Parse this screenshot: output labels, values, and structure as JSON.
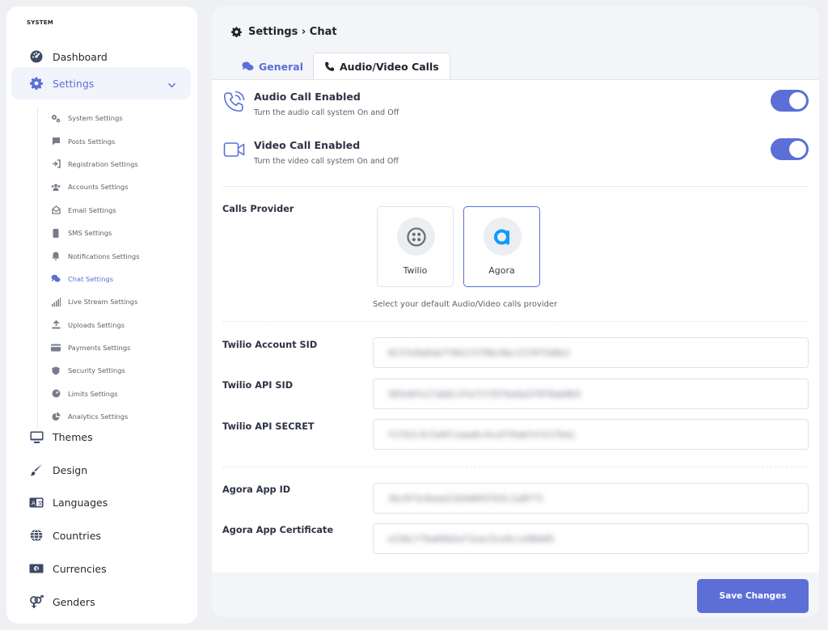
{
  "sidebar": {
    "section_title": "SYSTEM",
    "dashboard": "Dashboard",
    "settings": "Settings",
    "sub_items": [
      "System Settings",
      "Posts Settings",
      "Registration Settings",
      "Accounts Settings",
      "Email Settings",
      "SMS Settings",
      "Notifications Settings",
      "Chat Settings",
      "Live Stream Settings",
      "Uploads Settings",
      "Payments Settings",
      "Security Settings",
      "Limits Settings",
      "Analytics Settings"
    ],
    "bottom_items": [
      "Themes",
      "Design",
      "Languages",
      "Countries",
      "Currencies",
      "Genders"
    ]
  },
  "header": {
    "breadcrumb": "Settings › Chat"
  },
  "tabs": {
    "general": "General",
    "calls": "Audio/Video Calls"
  },
  "calls": {
    "audio_title": "Audio Call Enabled",
    "audio_desc": "Turn the audio call system On and Off",
    "audio_enabled": true,
    "video_title": "Video Call Enabled",
    "video_desc": "Turn the video call system On and Off",
    "video_enabled": true
  },
  "provider": {
    "label": "Calls Provider",
    "options": [
      "Twilio",
      "Agora"
    ],
    "selected": "Agora",
    "hint": "Select your default Audio/Video calls provider"
  },
  "fields": {
    "twilio_sid_label": "Twilio Account SID",
    "twilio_sid_value": "AC3fe9a6ab7f6b1f2f0bc8ac21f0f5d8a1",
    "twilio_api_sid_label": "Twilio API SID",
    "twilio_api_sid_value": "SK5e0fe17ab6c3fa71f35fbe6a3f0f0ab0b5",
    "twilio_api_secret_label": "Twilio API SECRET",
    "twilio_api_secret_value": "Y1fb2c4c5a9fcaaa6c4ce5f6abfefe17bdj",
    "agora_app_id_label": "Agora App ID",
    "agora_app_id_value": "3bc0f3c6ead11b4d0437b5c1a8f71",
    "agora_cert_label": "Agora App Certificate",
    "agora_cert_value": "e13bcf7ba69d2ef1eac5ce9cce96b05"
  },
  "actions": {
    "save": "Save Changes"
  },
  "colors": {
    "accent": "#5b6fd6",
    "sidebar_icon": "#4a5568",
    "twilio_logo": "#6b6f78",
    "agora_logo": "#099dfd"
  }
}
